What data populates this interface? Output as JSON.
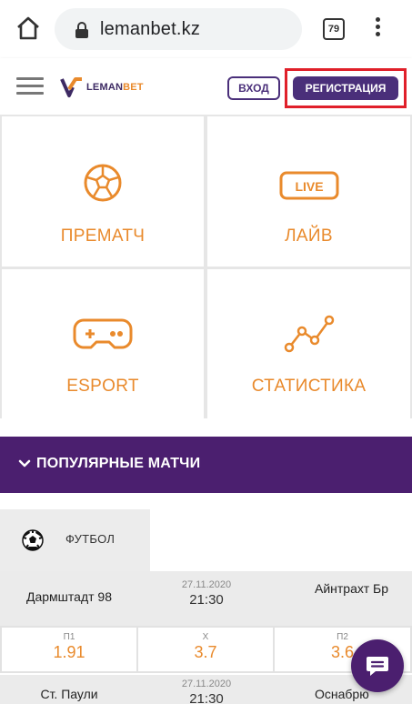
{
  "browser": {
    "url": "lemanbet.kz",
    "tab_count": "79",
    "icons": {
      "home": "home-icon",
      "lock": "lock-icon",
      "menu": "more-vert-icon"
    }
  },
  "header": {
    "logo_text_main": "LEMAN",
    "logo_text_accent": "BET",
    "login_label": "ВХОД",
    "register_label": "РЕГИСТРАЦИЯ",
    "colors": {
      "brand_purple": "#4a2f7a",
      "accent_orange": "#e98a2c",
      "highlight_red": "#e0202a"
    }
  },
  "tiles": [
    {
      "label": "ПРЕМАТЧ",
      "icon": "soccer-ball-icon"
    },
    {
      "label": "ЛАЙВ",
      "icon": "live-badge-icon",
      "badge_text": "LIVE"
    },
    {
      "label": "ESPORT",
      "icon": "gamepad-icon"
    },
    {
      "label": "СТАТИСТИКА",
      "icon": "line-chart-icon"
    }
  ],
  "popular": {
    "title": "ПОПУЛЯРНЫЕ МАТЧИ",
    "color": "#4b1f6f"
  },
  "sport_tab": {
    "label": "ФУТБОЛ",
    "icon": "soccer-ball-icon"
  },
  "matches": [
    {
      "home": "Дармштадт 98",
      "date": "27.11.2020",
      "time": "21:30",
      "away": "Айнтрахт Бр",
      "odds": [
        {
          "key": "П1",
          "value": "1.91"
        },
        {
          "key": "Х",
          "value": "3.7"
        },
        {
          "key": "П2",
          "value": "3.6"
        }
      ]
    },
    {
      "home": "Ст. Паули",
      "date": "27.11.2020",
      "time": "21:30",
      "away": "Оснабрю"
    }
  ]
}
